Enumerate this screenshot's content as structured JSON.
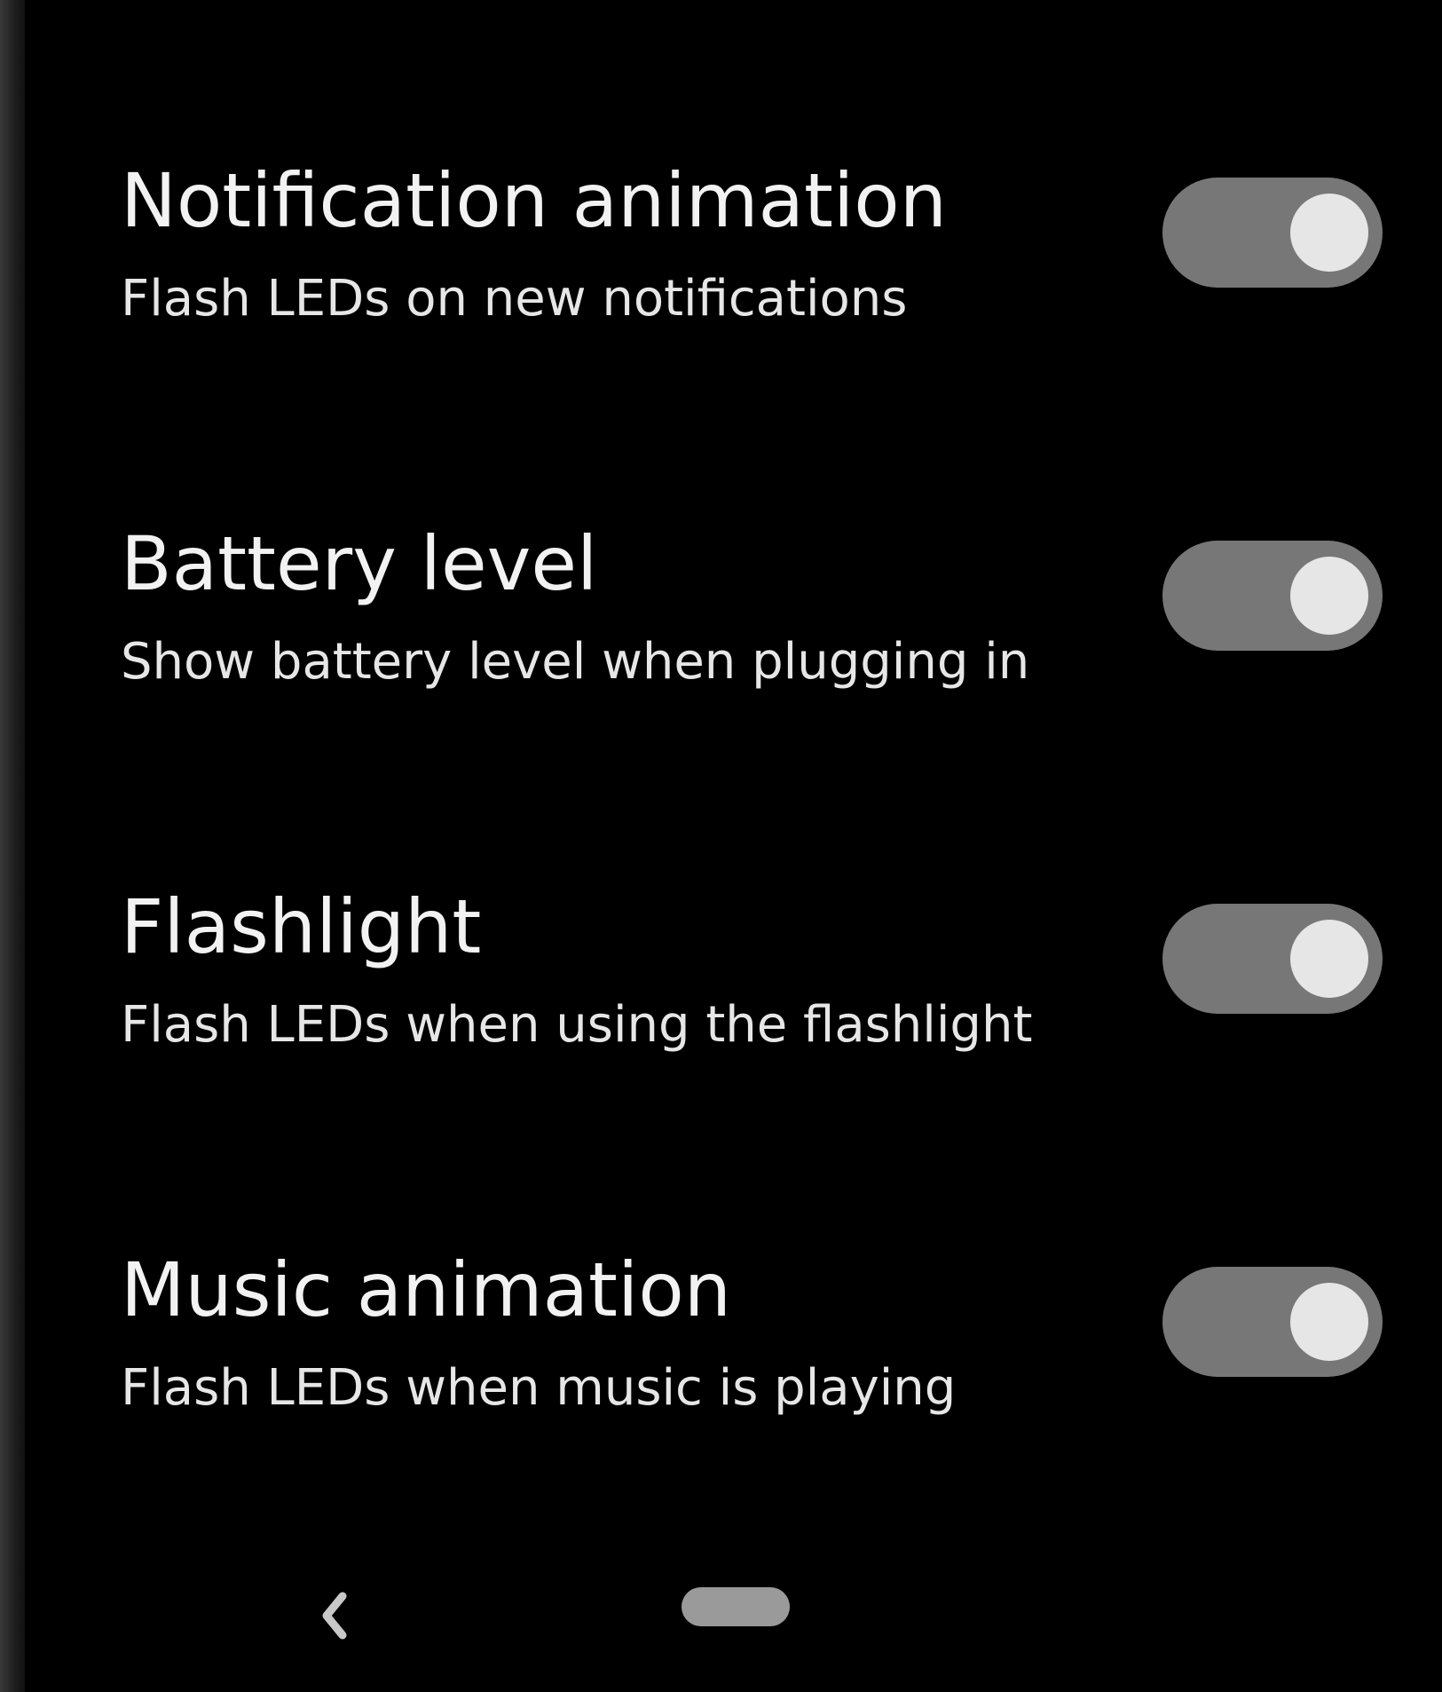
{
  "settings": [
    {
      "title": "Notification animation",
      "summary": "Flash LEDs on new notifications",
      "enabled": true
    },
    {
      "title": "Battery level",
      "summary": "Show battery level when plugging in",
      "enabled": true
    },
    {
      "title": "Flashlight",
      "summary": "Flash LEDs when using the flashlight",
      "enabled": true
    },
    {
      "title": "Music animation",
      "summary": "Flash LEDs when music is playing",
      "enabled": true
    }
  ],
  "colors": {
    "background": "#000000",
    "toggle_track": "#777777",
    "toggle_knob": "#e6e6e6",
    "nav_pill": "#9a9a9a"
  },
  "nav": {
    "back_icon": "chevron-left-icon",
    "home_icon": "home-pill-icon"
  }
}
